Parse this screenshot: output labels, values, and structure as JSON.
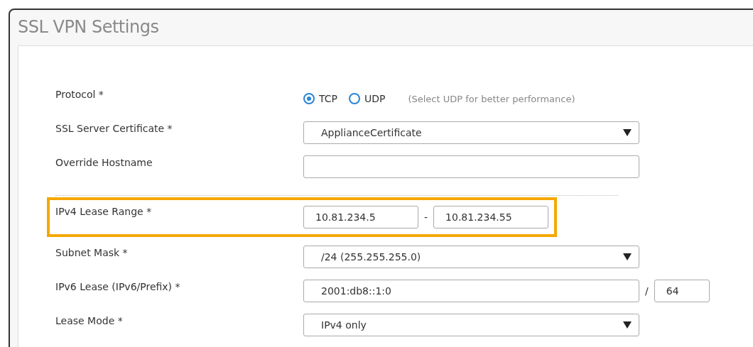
{
  "window": {
    "title": "SSL VPN Settings"
  },
  "sections": [
    {
      "fields": [
        {
          "kind": "radio",
          "label": "Protocol *",
          "highlighted": false,
          "options": [
            {
              "label": "TCP",
              "selected": true
            },
            {
              "label": "UDP",
              "selected": false
            }
          ],
          "hint": "(Select UDP for better performance)"
        },
        {
          "kind": "select",
          "label": "SSL Server Certificate *",
          "highlighted": false,
          "value": "ApplianceCertificate"
        },
        {
          "kind": "text",
          "label": "Override Hostname",
          "highlighted": false
        }
      ]
    },
    {
      "fields": [
        {
          "kind": "range",
          "label": "IPv4 Lease Range *",
          "highlighted": true,
          "from": "10.81.234.5",
          "separator": "-",
          "to": "10.81.234.55"
        },
        {
          "kind": "select",
          "label": "Subnet Mask *",
          "highlighted": false,
          "value": "/24 (255.255.255.0)"
        },
        {
          "kind": "prefix",
          "label": "IPv6 Lease (IPv6/Prefix) *",
          "highlighted": false,
          "value": "2001:db8::1:0",
          "separator": "/",
          "prefix": "64"
        },
        {
          "kind": "select",
          "label": "Lease Mode *",
          "highlighted": false,
          "value": "IPv4 only"
        }
      ]
    }
  ]
}
